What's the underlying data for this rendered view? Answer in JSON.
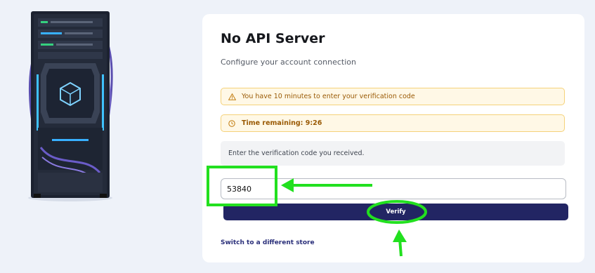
{
  "card": {
    "title": "No API Server",
    "subtitle": "Configure your account connection"
  },
  "alerts": {
    "warning_text": "You have 10 minutes to enter your verification code",
    "timer_text": "Time remaining: 9:26",
    "color": "#9a5a05"
  },
  "verification": {
    "instruction": "Enter the verification code you received.",
    "code_value": "53840"
  },
  "actions": {
    "verify_label": "Verify",
    "switch_store_label": "Switch to a different store"
  },
  "colors": {
    "primary": "#222563",
    "annotation": "#22e01f",
    "background": "#eef2f9"
  },
  "icons": {
    "warning": "warning-triangle-icon",
    "timer": "clock-icon"
  }
}
